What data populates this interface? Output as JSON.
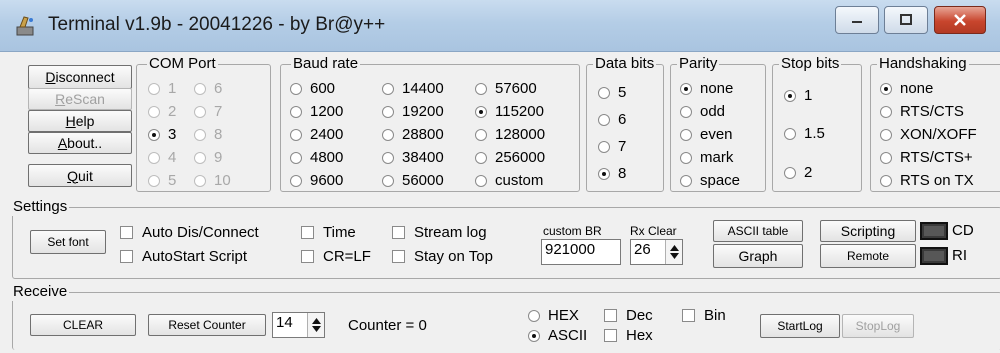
{
  "window": {
    "title": "Terminal v1.9b - 20041226 - by Br@y++"
  },
  "left_buttons": {
    "disconnect": "Disconnect",
    "rescan": "ReScan",
    "help": "Help",
    "about": "About..",
    "quit": "Quit"
  },
  "com_port": {
    "legend": "COM Port",
    "options": [
      "1",
      "2",
      "3",
      "4",
      "5",
      "6",
      "7",
      "8",
      "9",
      "10"
    ],
    "selected": "3"
  },
  "baud_rate": {
    "legend": "Baud rate",
    "options": [
      "600",
      "1200",
      "2400",
      "4800",
      "9600",
      "14400",
      "19200",
      "28800",
      "38400",
      "56000",
      "57600",
      "115200",
      "128000",
      "256000",
      "custom"
    ],
    "selected": "115200"
  },
  "data_bits": {
    "legend": "Data bits",
    "options": [
      "5",
      "6",
      "7",
      "8"
    ],
    "selected": "8"
  },
  "parity": {
    "legend": "Parity",
    "options": [
      "none",
      "odd",
      "even",
      "mark",
      "space"
    ],
    "selected": "none"
  },
  "stop_bits": {
    "legend": "Stop bits",
    "options": [
      "1",
      "1.5",
      "2"
    ],
    "selected": "1"
  },
  "handshaking": {
    "legend": "Handshaking",
    "options": [
      "none",
      "RTS/CTS",
      "XON/XOFF",
      "RTS/CTS+",
      "RTS on TX"
    ],
    "selected": "none"
  },
  "settings": {
    "legend": "Settings",
    "set_font": "Set font",
    "auto_dis_connect": "Auto Dis/Connect",
    "autostart_script": "AutoStart Script",
    "time": "Time",
    "cr_lf": "CR=LF",
    "stream_log": "Stream log",
    "stay_on_top": "Stay on Top",
    "custom_br_label": "custom BR",
    "custom_br_value": "921000",
    "rx_clear_label": "Rx Clear",
    "rx_clear_value": "26",
    "ascii_table": "ASCII table",
    "scripting": "Scripting",
    "graph": "Graph",
    "remote": "Remote",
    "cd": "CD",
    "ri": "RI"
  },
  "receive": {
    "legend": "Receive",
    "clear": "CLEAR",
    "reset_counter": "Reset Counter",
    "counter_spin_value": "14",
    "counter_label": "Counter = ",
    "counter_value": "0",
    "hex": "HEX",
    "ascii": "ASCII",
    "format_selected": "ASCII",
    "dec": "Dec",
    "hex_check": "Hex",
    "bin": "Bin",
    "start_log": "StartLog",
    "stop_log": "StopLog"
  }
}
